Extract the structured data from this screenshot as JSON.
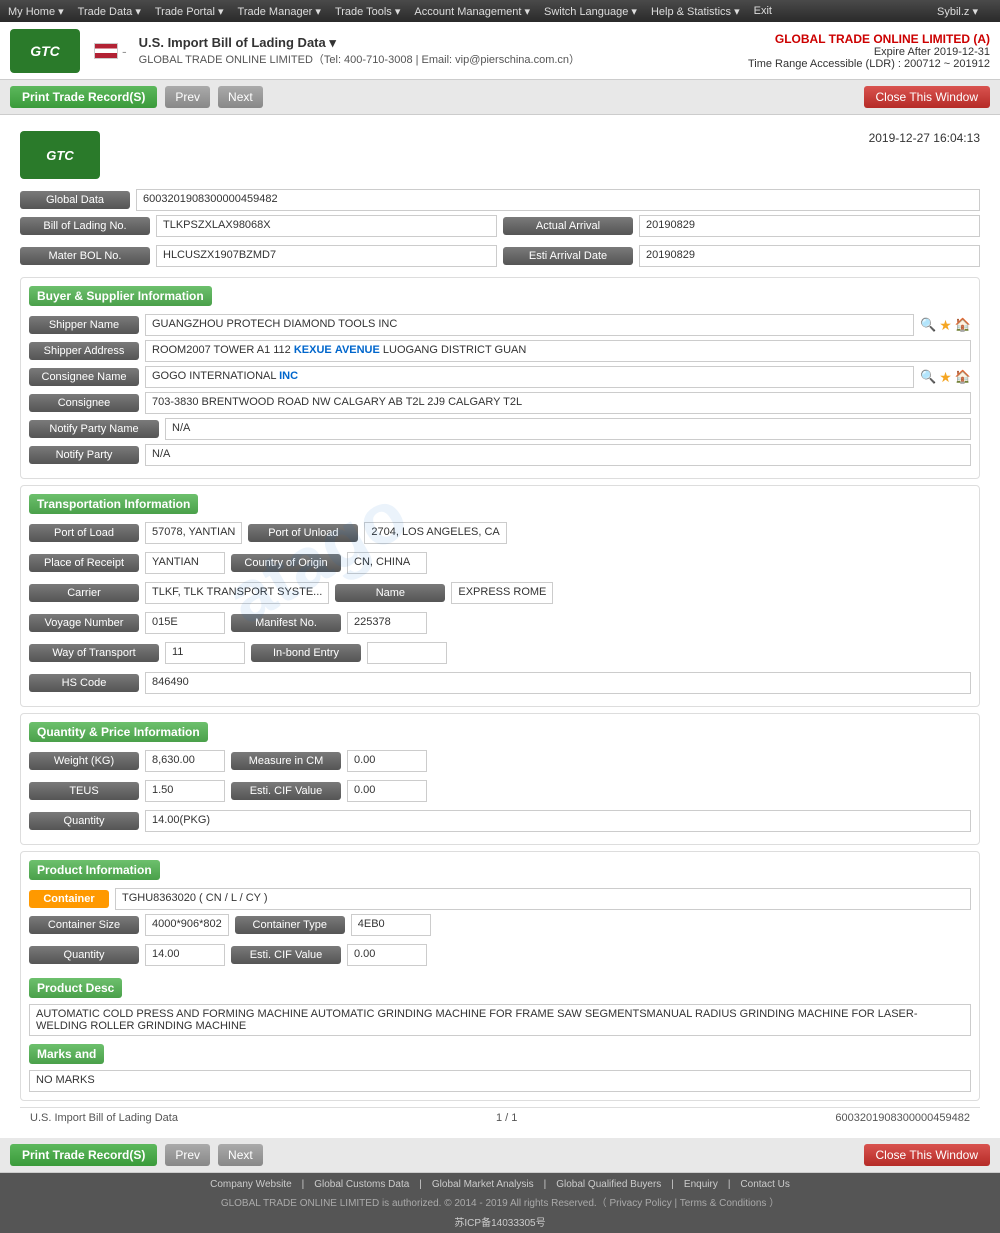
{
  "menu": {
    "items": [
      "My Home ▾",
      "Trade Data ▾",
      "Trade Portal ▾",
      "Trade Manager ▾",
      "Trade Tools ▾",
      "Account Management ▾",
      "Switch Language ▾",
      "Help & Statistics ▾",
      "Exit"
    ],
    "user": "Sybil.z ▾"
  },
  "header": {
    "logo_text": "GTC",
    "flag_alt": "US Flag",
    "title": "U.S. Import Bill of Lading Data ▾",
    "contact": "GLOBAL TRADE ONLINE LIMITED（Tel: 400-710-3008 | Email: vip@pierschina.com.cn）",
    "company": "GLOBAL TRADE ONLINE LIMITED (A)",
    "expire": "Expire After 2019-12-31",
    "time_range": "Time Range Accessible (LDR) : 200712 ~ 201912"
  },
  "toolbar": {
    "print_label": "Print Trade Record(S)",
    "prev_label": "Prev",
    "next_label": "Next",
    "close_label": "Close This Window"
  },
  "document": {
    "timestamp": "2019-12-27 16:04:13",
    "global_data_label": "Global Data",
    "global_data_value": "6003201908300000459482",
    "bill_of_lading_label": "Bill of Lading No.",
    "bill_of_lading_value": "TLKPSZXLAX98068X",
    "actual_arrival_label": "Actual Arrival",
    "actual_arrival_value": "20190829",
    "mater_bol_label": "Mater BOL No.",
    "mater_bol_value": "HLCUSZX1907BZMD7",
    "esti_arrival_label": "Esti Arrival Date",
    "esti_arrival_value": "20190829"
  },
  "buyer_supplier": {
    "title": "Buyer & Supplier Information",
    "shipper_name_label": "Shipper Name",
    "shipper_name_value": "GUANGZHOU PROTECH DIAMOND TOOLS INC",
    "shipper_address_label": "Shipper Address",
    "shipper_address_value": "ROOM2007 TOWER A1 112 KEXUE AVENUE LUOGANG DISTRICT GUAN",
    "consignee_name_label": "Consignee Name",
    "consignee_name_value": "GOGO INTERNATIONAL INC",
    "consignee_label": "Consignee",
    "consignee_value": "703-3830 BRENTWOOD ROAD NW CALGARY AB T2L 2J9 CALGARY T2L",
    "notify_party_name_label": "Notify Party Name",
    "notify_party_name_value": "N/A",
    "notify_party_label": "Notify Party",
    "notify_party_value": "N/A"
  },
  "transportation": {
    "title": "Transportation Information",
    "port_of_load_label": "Port of Load",
    "port_of_load_value": "57078, YANTIAN",
    "port_of_unload_label": "Port of Unload",
    "port_of_unload_value": "2704, LOS ANGELES, CA",
    "place_of_receipt_label": "Place of Receipt",
    "place_of_receipt_value": "YANTIAN",
    "country_of_origin_label": "Country of Origin",
    "country_of_origin_value": "CN, CHINA",
    "carrier_label": "Carrier",
    "carrier_value": "TLKF, TLK TRANSPORT SYSTE...",
    "name_label": "Name",
    "name_value": "EXPRESS ROME",
    "voyage_number_label": "Voyage Number",
    "voyage_number_value": "015E",
    "manifest_no_label": "Manifest No.",
    "manifest_no_value": "225378",
    "way_of_transport_label": "Way of Transport",
    "way_of_transport_value": "11",
    "inbond_entry_label": "In-bond Entry",
    "inbond_entry_value": "",
    "hs_code_label": "HS Code",
    "hs_code_value": "846490"
  },
  "quantity_price": {
    "title": "Quantity & Price Information",
    "weight_label": "Weight (KG)",
    "weight_value": "8,630.00",
    "measure_cm_label": "Measure in CM",
    "measure_cm_value": "0.00",
    "teus_label": "TEUS",
    "teus_value": "1.50",
    "esti_cif_label": "Esti. CIF Value",
    "esti_cif_value": "0.00",
    "quantity_label": "Quantity",
    "quantity_value": "14.00(PKG)"
  },
  "product_info": {
    "title": "Product Information",
    "container_label": "Container",
    "container_value": "TGHU8363020 ( CN / L / CY )",
    "container_size_label": "Container Size",
    "container_size_value": "4000*906*802",
    "container_type_label": "Container Type",
    "container_type_value": "4EB0",
    "quantity_label": "Quantity",
    "quantity_value": "14.00",
    "esti_cif_label": "Esti. CIF Value",
    "esti_cif_value": "0.00",
    "product_desc_title": "Product Desc",
    "product_desc": "AUTOMATIC COLD PRESS AND FORMING MACHINE AUTOMATIC GRINDING MACHINE FOR FRAME SAW SEGMENTSMANUAL RADIUS GRINDING MACHINE FOR LASER-WELDING ROLLER GRINDING MACHINE",
    "marks_title": "Marks and",
    "marks_value": "NO MARKS"
  },
  "doc_footer": {
    "label": "U.S. Import Bill of Lading Data",
    "page": "1 / 1",
    "id": "6003201908300000459482"
  },
  "page_footer": {
    "icp": "苏ICP备14033305号",
    "links": [
      "Company Website",
      "Global Customs Data",
      "Global Market Analysis",
      "Global Qualified Buyers",
      "Enquiry",
      "Contact Us"
    ],
    "copyright": "GLOBAL TRADE ONLINE LIMITED is authorized. © 2014 - 2019 All rights Reserved.（",
    "privacy": "Privacy Policy",
    "separator": "|",
    "terms": "Terms & Conditions",
    "closing": "）"
  },
  "watermark": "atago"
}
